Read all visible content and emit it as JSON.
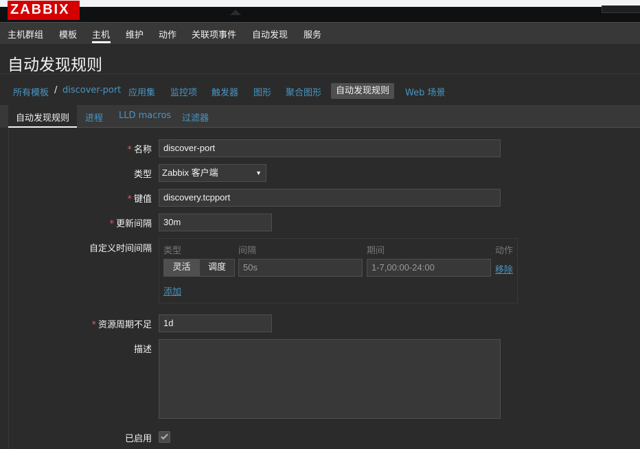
{
  "brand": {
    "logo_text": "ZABBIX",
    "logo_color": "#d40000"
  },
  "mainnav": {
    "items": [
      {
        "label": "主机群组"
      },
      {
        "label": "模板"
      },
      {
        "label": "主机"
      },
      {
        "label": "维护"
      },
      {
        "label": "动作"
      },
      {
        "label": "关联项事件"
      },
      {
        "label": "自动发现"
      },
      {
        "label": "服务"
      }
    ],
    "active_index": 2
  },
  "page": {
    "title": "自动发现规则"
  },
  "breadcrumb": {
    "items": [
      {
        "label": "所有模板"
      },
      {
        "label": "/"
      },
      {
        "label": "discover-port"
      },
      {
        "label": "应用集"
      },
      {
        "label": "监控项"
      },
      {
        "label": "触发器"
      },
      {
        "label": "图形"
      },
      {
        "label": "聚合图形"
      },
      {
        "label": "自动发现规则"
      },
      {
        "label": "Web 场景"
      }
    ],
    "selected_index": 8
  },
  "tabs": {
    "items": [
      {
        "label": "自动发现规则"
      },
      {
        "label": "进程"
      },
      {
        "label": "LLD macros"
      },
      {
        "label": "过滤器"
      }
    ],
    "active_index": 0
  },
  "form": {
    "name": {
      "label": "名称",
      "value": "discover-port",
      "required": true
    },
    "type": {
      "label": "类型",
      "value": "Zabbix 客户端"
    },
    "key": {
      "label": "键值",
      "value": "discovery.tcpport",
      "required": true
    },
    "interval": {
      "label": "更新间隔",
      "value": "30m",
      "required": true
    },
    "custom_intervals": {
      "label": "自定义时间间隔",
      "headers": {
        "type": "类型",
        "interval": "间隔",
        "period": "期间",
        "action": "动作"
      },
      "rows": [
        {
          "type_options": [
            "灵活",
            "调度"
          ],
          "type_selected": "灵活",
          "interval_placeholder": "50s",
          "period_placeholder": "1-7,00:00-24:00",
          "remove_label": "移除"
        }
      ],
      "add_label": "添加"
    },
    "lifetime": {
      "label": "资源周期不足",
      "value": "1d",
      "required": true
    },
    "description": {
      "label": "描述",
      "value": ""
    },
    "enabled": {
      "label": "已启用",
      "checked": true
    }
  },
  "colors": {
    "link": "#4796c4",
    "required": "#e45959",
    "bg": "#2b2b2b",
    "panel": "#383838"
  }
}
